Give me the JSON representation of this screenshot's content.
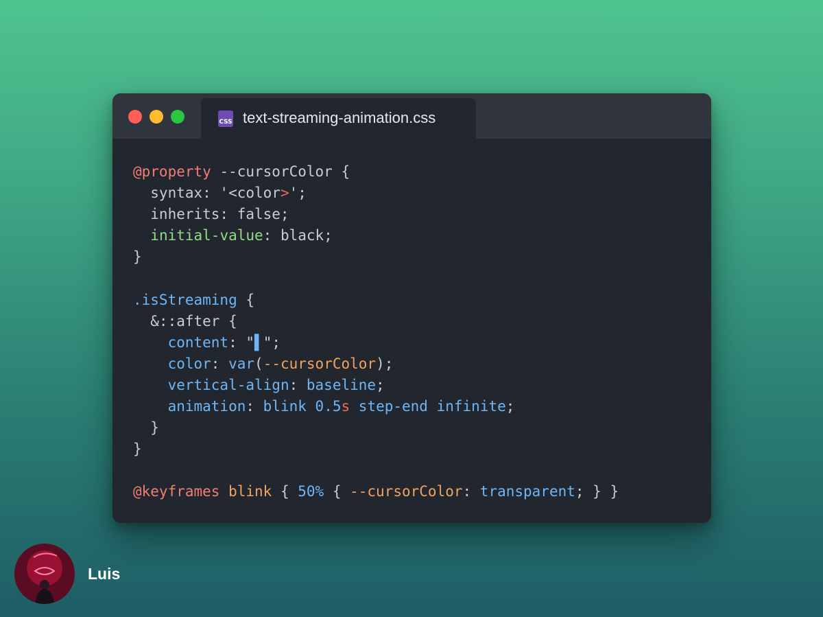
{
  "window": {
    "controls": [
      "close",
      "minimize",
      "maximize"
    ],
    "tab": {
      "icon": "css-file-icon",
      "icon_label": "CSS",
      "filename": "text-streaming-animation.css"
    }
  },
  "colors": {
    "background_top": "#4fc48f",
    "background_bottom": "#1e5d66",
    "editor_bg": "#22262e",
    "titlebar_bg": "#30343c",
    "keyword_at": "#f07f73",
    "property_green": "#8fdc85",
    "value_blue": "#6fb6f5",
    "name_orange": "#f2a35c"
  },
  "code": {
    "lines": [
      [
        {
          "t": "@property",
          "c": "at"
        },
        {
          "t": " --cursorColor {",
          "c": "text"
        }
      ],
      [
        {
          "t": "  syntax: '<color",
          "c": "text"
        },
        {
          "t": ">",
          "c": "red"
        },
        {
          "t": "';",
          "c": "text"
        }
      ],
      [
        {
          "t": "  inherits: false;",
          "c": "text"
        }
      ],
      [
        {
          "t": "  ",
          "c": "text"
        },
        {
          "t": "initial-value",
          "c": "green"
        },
        {
          "t": ": black;",
          "c": "text"
        }
      ],
      [
        {
          "t": "}",
          "c": "text"
        }
      ],
      [],
      [
        {
          "t": ".isStreaming",
          "c": "blue"
        },
        {
          "t": " {",
          "c": "text"
        }
      ],
      [
        {
          "t": "  &::after {",
          "c": "text"
        }
      ],
      [
        {
          "t": "    ",
          "c": "text"
        },
        {
          "t": "content",
          "c": "blue"
        },
        {
          "t": ": \"",
          "c": "text"
        },
        {
          "t": "▌",
          "c": "cursor"
        },
        {
          "t": "\";",
          "c": "text"
        }
      ],
      [
        {
          "t": "    ",
          "c": "text"
        },
        {
          "t": "color",
          "c": "blue"
        },
        {
          "t": ": ",
          "c": "text"
        },
        {
          "t": "var",
          "c": "blue"
        },
        {
          "t": "(",
          "c": "text"
        },
        {
          "t": "--cursorColor",
          "c": "orange"
        },
        {
          "t": ");",
          "c": "text"
        }
      ],
      [
        {
          "t": "    ",
          "c": "text"
        },
        {
          "t": "vertical-align",
          "c": "blue"
        },
        {
          "t": ": ",
          "c": "text"
        },
        {
          "t": "baseline",
          "c": "blue"
        },
        {
          "t": ";",
          "c": "text"
        }
      ],
      [
        {
          "t": "    ",
          "c": "text"
        },
        {
          "t": "animation",
          "c": "blue"
        },
        {
          "t": ": ",
          "c": "text"
        },
        {
          "t": "blink",
          "c": "blue"
        },
        {
          "t": " ",
          "c": "text"
        },
        {
          "t": "0.5",
          "c": "blue"
        },
        {
          "t": "s",
          "c": "red"
        },
        {
          "t": " ",
          "c": "text"
        },
        {
          "t": "step-end",
          "c": "blue"
        },
        {
          "t": " ",
          "c": "text"
        },
        {
          "t": "infinite",
          "c": "blue"
        },
        {
          "t": ";",
          "c": "text"
        }
      ],
      [
        {
          "t": "  }",
          "c": "text"
        }
      ],
      [
        {
          "t": "}",
          "c": "text"
        }
      ],
      [],
      [
        {
          "t": "@keyframes",
          "c": "at"
        },
        {
          "t": " ",
          "c": "text"
        },
        {
          "t": "blink",
          "c": "orange"
        },
        {
          "t": " { ",
          "c": "text"
        },
        {
          "t": "50%",
          "c": "blue"
        },
        {
          "t": " { ",
          "c": "text"
        },
        {
          "t": "--cursorColor",
          "c": "orange"
        },
        {
          "t": ": ",
          "c": "text"
        },
        {
          "t": "transparent",
          "c": "blue"
        },
        {
          "t": "; } }",
          "c": "text"
        }
      ]
    ]
  },
  "author": {
    "name": "Luis",
    "avatar_icon": "profile-photo"
  }
}
